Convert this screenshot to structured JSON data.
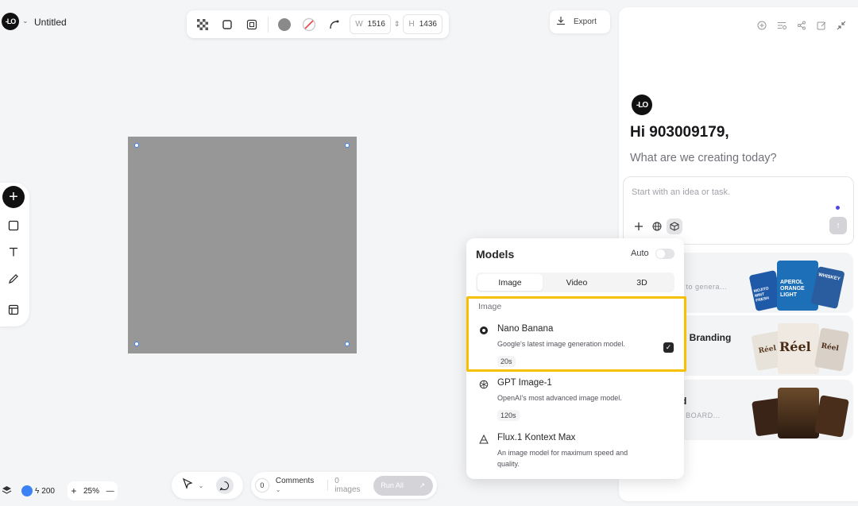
{
  "header": {
    "title": "Untitled",
    "logo_text": "-LO"
  },
  "toolbar": {
    "width_label": "W",
    "width_value": "1516",
    "height_label": "H",
    "height_value": "1436"
  },
  "export": {
    "label": "Export"
  },
  "bottom": {
    "credits": "200",
    "zoom": "25%",
    "zoom_in": "+",
    "zoom_out": "—",
    "comments_count": "0",
    "comments_label": "Comments",
    "images_count": "0 images",
    "run_all": "Run All"
  },
  "panel": {
    "logo_text": "-LO",
    "greeting": "Hi 903009179,",
    "subgreeting": "What are we creating today?",
    "prompt_placeholder": "Start with an idea or task.",
    "cards": [
      {
        "title": "",
        "subtitle": "ect to genera..."
      },
      {
        "title": "p Branding",
        "subtitle": ""
      },
      {
        "title": "d",
        "subtitle": "RY BOARD..."
      }
    ],
    "thumb_texts": [
      "APEROL ORANGE LIGHT",
      "MOJITO MINT FRESH",
      "WHISKEY",
      "Réel",
      "Réel",
      "Réel"
    ]
  },
  "models": {
    "title": "Models",
    "auto_label": "Auto",
    "tabs": [
      "Image",
      "Video",
      "3D"
    ],
    "section_label": "Image",
    "items": [
      {
        "name": "Nano Banana",
        "desc": "Google's latest image generation model.",
        "time": "20s",
        "icon": "banana-icon"
      },
      {
        "name": "GPT Image-1",
        "desc": "OpenAI's most advanced image model.",
        "time": "120s",
        "icon": "openai-icon"
      },
      {
        "name": "Flux.1 Kontext Max",
        "desc": "An image model for maximum speed and quality.",
        "time": "",
        "icon": "flux-icon"
      }
    ]
  },
  "colors": {
    "highlight": "#f5c000",
    "accent": "#4f46e5",
    "artboard": "#979797"
  }
}
